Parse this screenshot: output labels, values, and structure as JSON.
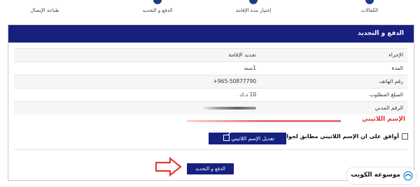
{
  "steps": [
    {
      "label": "طباعة الإيصال"
    },
    {
      "label": "الدفع و التجديد"
    },
    {
      "label": "إختيار مدة الإقامة"
    },
    {
      "label": "الكفالات"
    }
  ],
  "panel": {
    "title": "الدفع و التجديد",
    "rows": [
      {
        "label": "الإجراء",
        "value": "تجديد الإقامة"
      },
      {
        "label": "المدة",
        "value": "1سنه"
      },
      {
        "label": "رقم الهاتف",
        "value": "+965-50877790"
      },
      {
        "label": "المبلغ المطلوب",
        "value": "10 د.ك"
      },
      {
        "label": "الرقم المدني",
        "value": ""
      }
    ],
    "latin_name_title": "الإسم اللاتيني",
    "agree_text": "أوافق على ان الإسم اللاتيني مطابق لجواز السفر",
    "edit_button": "تعديل الإسم اللاتيني",
    "pay_button": "الدفع و التجديد"
  },
  "logo": {
    "text": "موسوعة الكويت"
  },
  "colors": {
    "primary": "#17207f",
    "accent_red": "#e53935"
  }
}
